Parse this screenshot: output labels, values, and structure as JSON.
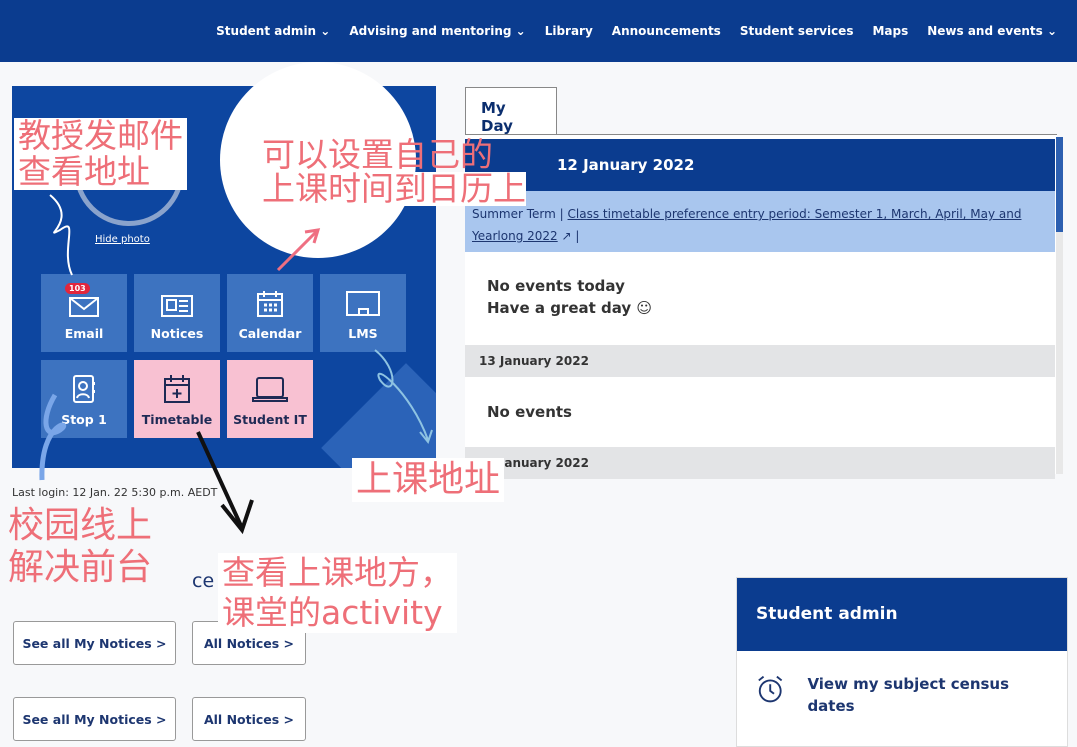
{
  "nav": {
    "items": [
      "Student admin ⌄",
      "Advising and mentoring ⌄",
      "Library",
      "Announcements",
      "Student services",
      "Maps",
      "News and events ⌄"
    ]
  },
  "hero": {
    "hide_photo": "Hide photo",
    "email_badge": "103",
    "tiles": [
      {
        "label": "Email",
        "icon": "envelope-icon"
      },
      {
        "label": "Notices",
        "icon": "newspaper-icon"
      },
      {
        "label": "Calendar",
        "icon": "calendar-icon"
      },
      {
        "label": "LMS",
        "icon": "laptop-board-icon"
      },
      {
        "label": "Stop 1",
        "icon": "contact-book-icon"
      },
      {
        "label": "Timetable",
        "icon": "calendar-plus-icon",
        "highlight": "#f8c1d2"
      },
      {
        "label": "Student IT",
        "icon": "laptop-icon",
        "highlight": "#f8c1d2"
      }
    ],
    "last_login": "Last login: 12 Jan. 22 5:30 p.m. AEDT"
  },
  "myday": {
    "tab": "My Day",
    "date": "12 January 2022",
    "term": "Summer Term",
    "link": "Class timetable preference entry period: Semester 1, March, April, May and Yearlong 2022",
    "sep": "|",
    "today_line1": "No events today",
    "today_line2": "Have a great day ☺",
    "day2": "13 January 2022",
    "day2_text": "No events",
    "day3": "14 January 2022"
  },
  "notices": {
    "partial_heading": "ce",
    "buttons": [
      "See all My Notices >",
      "All Notices >",
      "See all My Notices >",
      "All Notices >"
    ]
  },
  "student_admin": {
    "title": "Student admin",
    "item": "View my subject census dates",
    "icon": "alarm-clock-icon"
  },
  "annotations": {
    "email": [
      "教授发邮件",
      "查看地址"
    ],
    "calendar": [
      "可以设置自己的",
      "上课时间到日历上"
    ],
    "lms": "上课地址",
    "stop1": [
      "校园线上",
      "解决前台"
    ],
    "timetable": [
      "查看上课地方，",
      "课堂的activity"
    ]
  },
  "colors": {
    "brand": "#0b3c8f",
    "annotation": "#ee6f78",
    "highlight": "#f8c1d2"
  }
}
